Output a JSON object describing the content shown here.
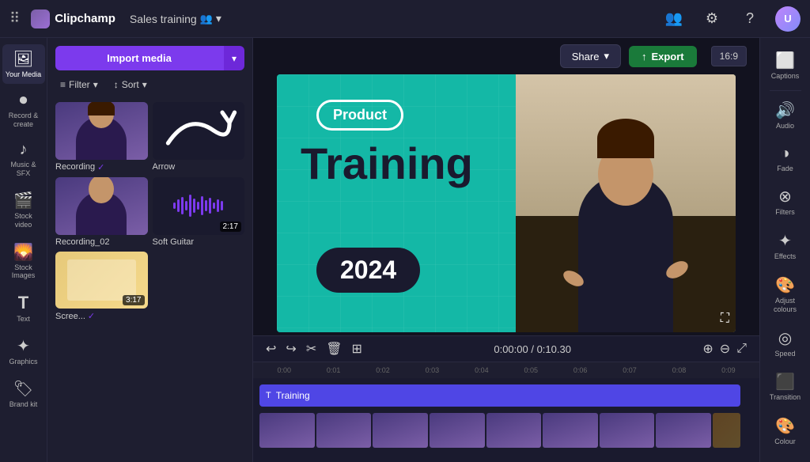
{
  "topbar": {
    "app_name": "Clipchamp",
    "project_name": "Sales training",
    "share_label": "Share",
    "export_label": "Export",
    "aspect_ratio": "16:9"
  },
  "left_sidebar": {
    "items": [
      {
        "id": "your-media",
        "label": "Your Media",
        "icon": "🖼"
      },
      {
        "id": "record-create",
        "label": "Record & create",
        "icon": "⏺"
      },
      {
        "id": "music-sfx",
        "label": "Music & SFX",
        "icon": "♪"
      },
      {
        "id": "stock-video",
        "label": "Stock video",
        "icon": "🎬"
      },
      {
        "id": "stock-images",
        "label": "Stock Images",
        "icon": "🌄"
      },
      {
        "id": "text",
        "label": "Text",
        "icon": "T"
      },
      {
        "id": "graphics",
        "label": "Graphics",
        "icon": "✦"
      },
      {
        "id": "brand-kit",
        "label": "Brand kit",
        "icon": "🏷"
      }
    ]
  },
  "media_panel": {
    "import_label": "Import media",
    "filter_label": "Filter",
    "sort_label": "Sort",
    "items": [
      {
        "id": "recording",
        "label": "Recording",
        "type": "video",
        "checked": true
      },
      {
        "id": "arrow",
        "label": "Arrow",
        "type": "drawing"
      },
      {
        "id": "recording02",
        "label": "Recording_02",
        "type": "video"
      },
      {
        "id": "soft-guitar",
        "label": "Soft Guitar",
        "type": "audio",
        "duration": "2:17"
      },
      {
        "id": "screenshot",
        "label": "Scree...",
        "type": "screen",
        "duration": "3:17",
        "checked": true
      }
    ]
  },
  "preview": {
    "product_label": "Product",
    "training_text": "Training",
    "year_text": "2024",
    "current_time": "0:00:00",
    "total_time": "0:10.30"
  },
  "timeline": {
    "current_time": "0:00:00 / 0:10.30",
    "ruler": [
      "0:00",
      "0:01",
      "0:02",
      "0:03",
      "0:04",
      "0:05",
      "0:06",
      "0:07",
      "0:08",
      "0:09"
    ],
    "track_title": "Training"
  },
  "right_panel": {
    "items": [
      {
        "id": "captions",
        "label": "Captions",
        "icon": "⬜"
      },
      {
        "id": "audio",
        "label": "Audio",
        "icon": "🔊"
      },
      {
        "id": "fade",
        "label": "Fade",
        "icon": "◑"
      },
      {
        "id": "filters",
        "label": "Filters",
        "icon": "⊗"
      },
      {
        "id": "effects",
        "label": "Effects",
        "icon": "✦"
      },
      {
        "id": "adjust-colours",
        "label": "Adjust colours",
        "icon": "🎨"
      },
      {
        "id": "speed",
        "label": "Speed",
        "icon": "◎"
      },
      {
        "id": "transition",
        "label": "Transition",
        "icon": "⬛"
      },
      {
        "id": "colour",
        "label": "Colour",
        "icon": "🎨"
      }
    ]
  }
}
